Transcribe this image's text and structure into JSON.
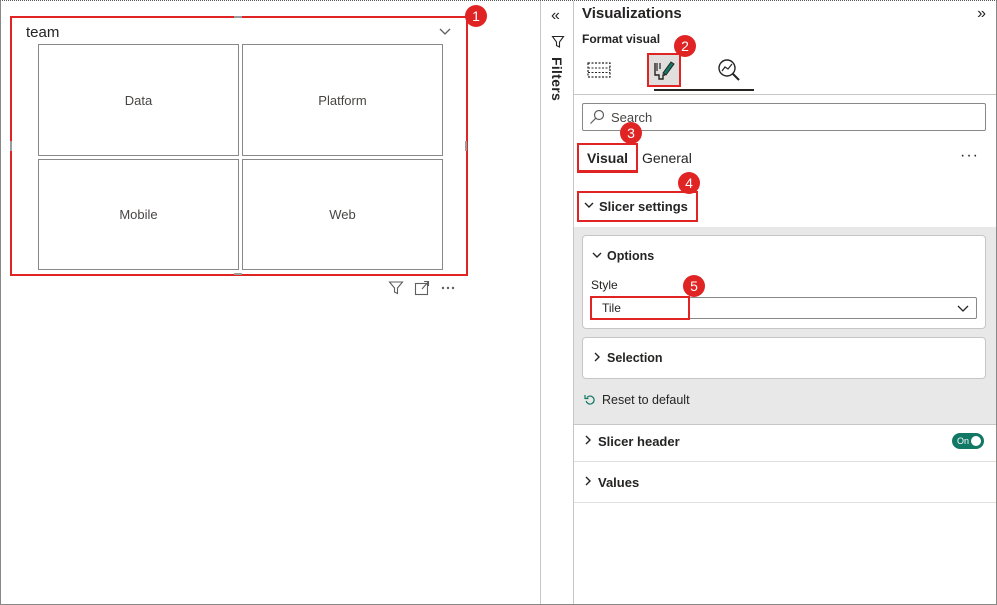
{
  "slicer": {
    "title": "team",
    "tiles": [
      "Data",
      "Platform",
      "Mobile",
      "Web"
    ]
  },
  "filters": {
    "label": "Filters"
  },
  "visualizations": {
    "title": "Visualizations",
    "format_visual_label": "Format visual",
    "search_placeholder": "Search",
    "tabs": {
      "visual": "Visual",
      "general": "General"
    },
    "sections": {
      "slicer_settings": "Slicer settings",
      "options": "Options",
      "style_label": "Style",
      "style_value": "Tile",
      "selection": "Selection",
      "reset": "Reset to default",
      "slicer_header": "Slicer header",
      "slicer_header_toggle": "On",
      "values": "Values"
    }
  },
  "annotations": [
    "1",
    "2",
    "3",
    "4",
    "5"
  ],
  "colors": {
    "annotation": "#e02424",
    "toggle_on": "#117865"
  }
}
